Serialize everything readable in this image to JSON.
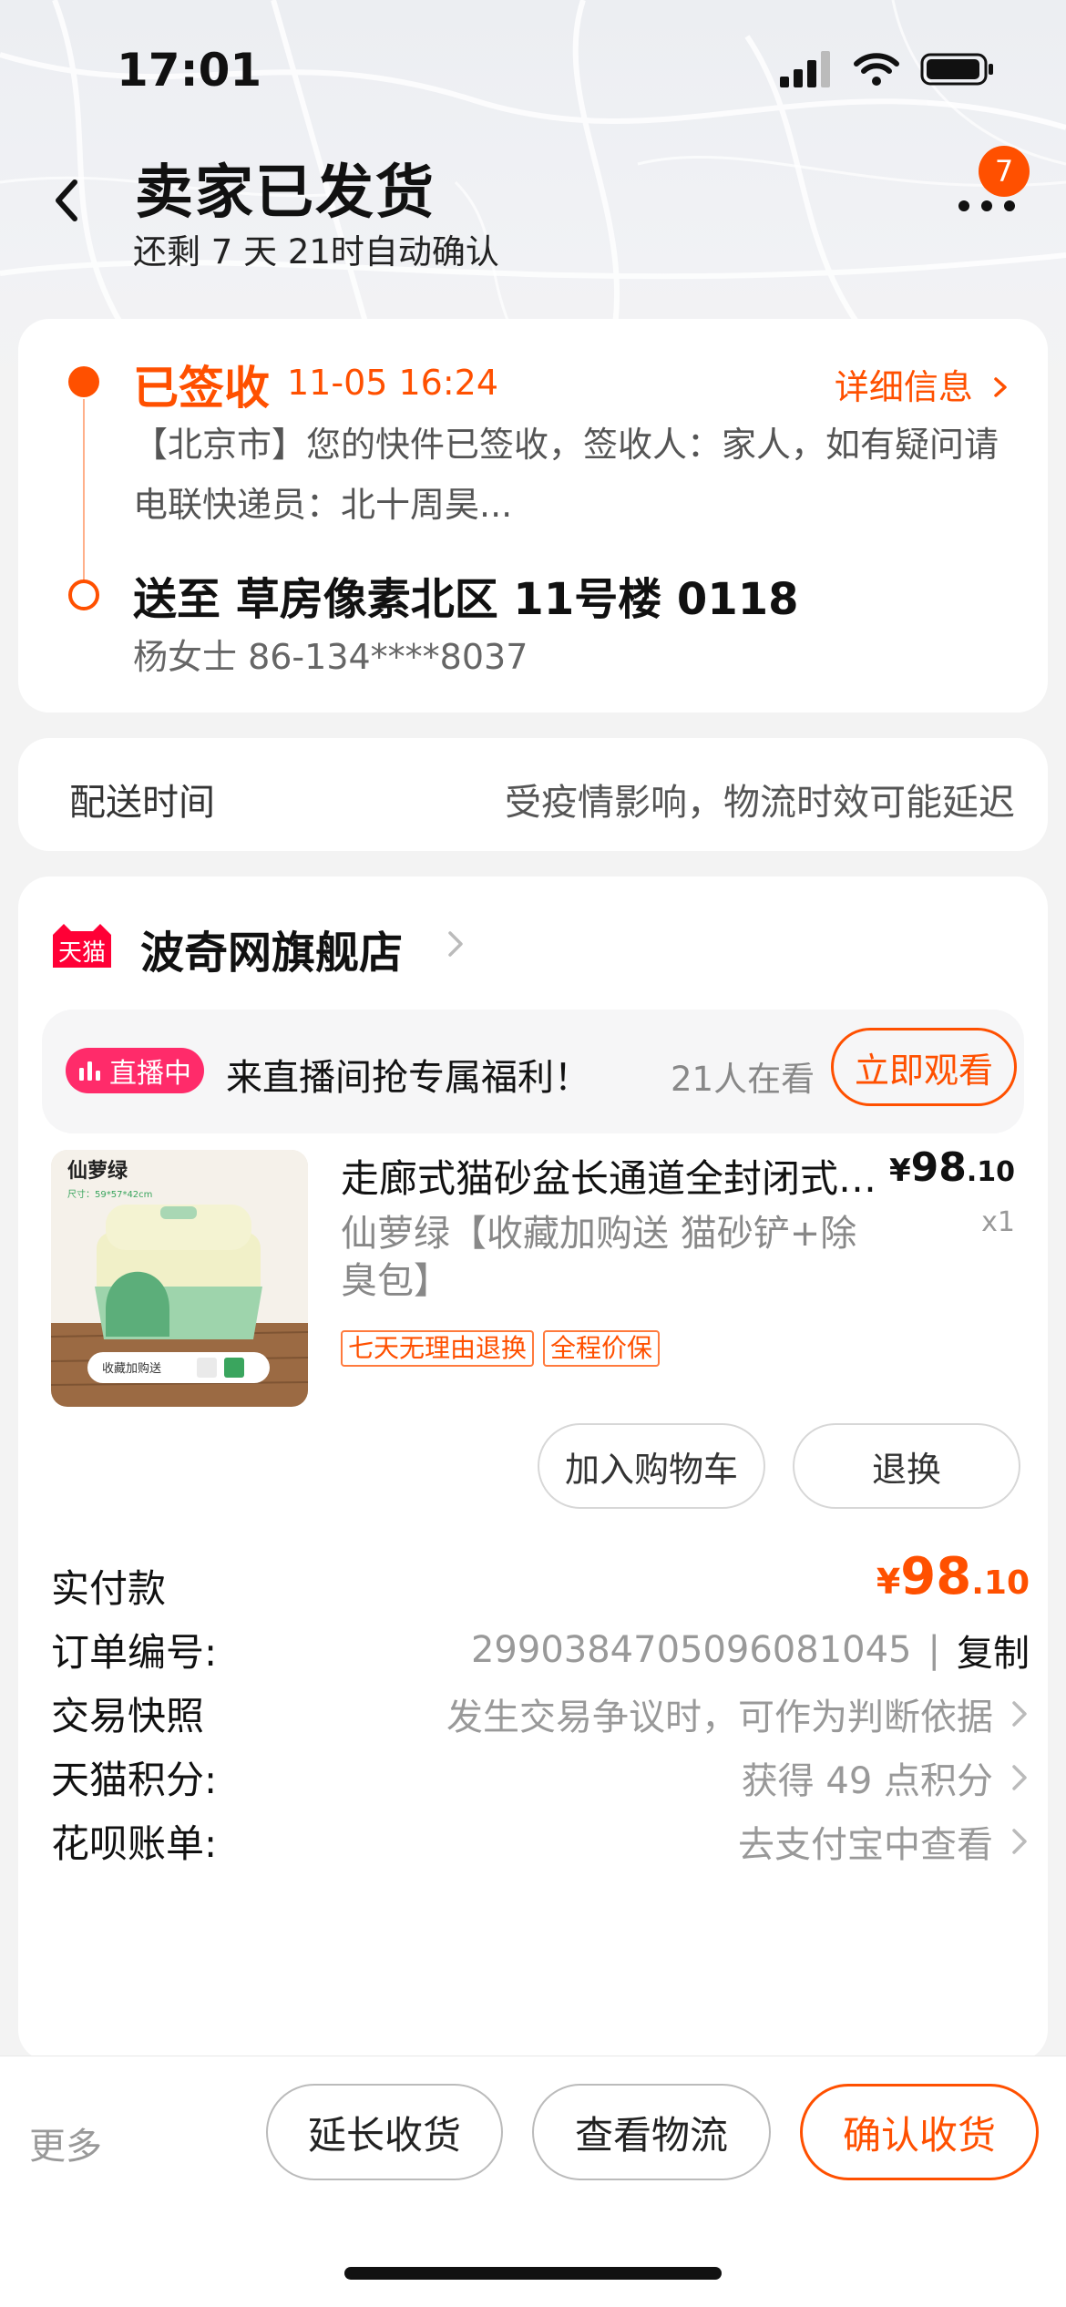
{
  "status_bar": {
    "time": "17:01"
  },
  "nav": {
    "title": "卖家已发货",
    "subtitle": "还剩 7 天 21时自动确认",
    "badge_count": "7"
  },
  "logistics": {
    "status": "已签收",
    "time": "11-05 16:24",
    "detail_link": "详细信息",
    "message": "【北京市】您的快件已签收，签收人：家人，如有疑问请电联快递员：北十周昊...",
    "ship_to": "送至 草房像素北区 11号楼 0118",
    "receiver": "杨女士 86-134****8037"
  },
  "delivery": {
    "label": "配送时间",
    "note": "受疫情影响，物流时效可能延迟"
  },
  "shop": {
    "logo_text": "天猫",
    "name": "波奇网旗舰店"
  },
  "live": {
    "tag": "直播中",
    "text": "来直播间抢专属福利！",
    "viewers": "21人在看",
    "watch_button": "立即观看"
  },
  "product": {
    "image_label": "仙萝绿",
    "image_spec": "尺寸：59*57*42cm",
    "image_promo": "收藏加购送",
    "title": "走廊式猫砂盆长通道全封闭式特大号猫厕所",
    "sku": "仙萝绿【收藏加购送 猫砂铲+除臭包】",
    "price_symbol": "¥",
    "price_int": "98",
    "price_dec": ".10",
    "qty": "x1",
    "tags": [
      "七天无理由退换",
      "全程价保"
    ],
    "add_cart_button": "加入购物车",
    "return_button": "退换"
  },
  "order": {
    "paid_label": "实付款",
    "paid_symbol": "¥",
    "paid_int": "98",
    "paid_dec": ".10",
    "order_no_label": "订单编号:",
    "order_no": "2990384705096081045",
    "copy_button": "复制",
    "snapshot_label": "交易快照",
    "snapshot_value": "发生交易争议时，可作为判断依据",
    "points_label": "天猫积分:",
    "points_value": "获得 49 点积分",
    "huabei_label": "花呗账单:",
    "huabei_value": "去支付宝中查看"
  },
  "bottom_bar": {
    "more": "更多",
    "extend_button": "延长收货",
    "track_button": "查看物流",
    "confirm_button": "确认收货"
  },
  "colors": {
    "accent": "#ff5000",
    "live_pink": "#ff2b6a",
    "tmall_red": "#ff0036"
  }
}
